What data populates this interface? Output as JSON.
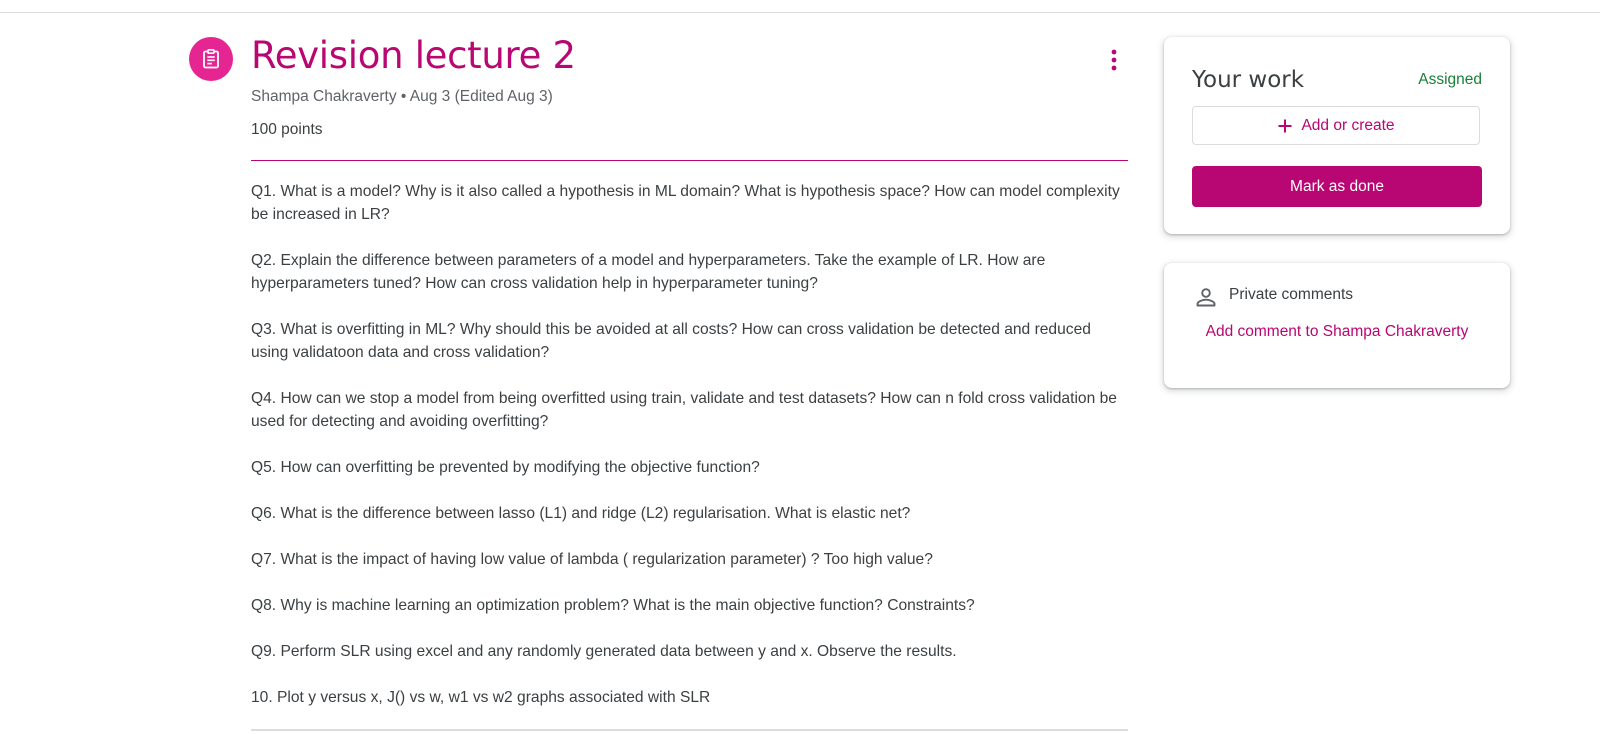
{
  "assignment": {
    "title": "Revision lecture 2",
    "meta": "Shampa Chakraverty • Aug 3 (Edited Aug 3)",
    "points": "100 points",
    "questions": [
      "Q1. What is a model? Why is it also called a hypothesis in ML domain? What is hypothesis space? How can model complexity be increased in LR?",
      "Q2. Explain the difference between parameters of a model and hyperparameters. Take the example of LR. How are hyperparameters tuned? How can cross validation help in hyperparameter tuning?",
      "Q3. What is overfitting in ML? Why should this be avoided at all costs? How can cross validation be detected and reduced using validatoon data and cross validation?",
      "Q4. How can we stop a model from being overfitted using train, validate and test datasets? How can n fold cross validation be used for detecting and avoiding overfitting?",
      "Q5. How can overfitting be prevented by modifying the objective function?",
      "Q6. What is the difference between lasso (L1) and ridge (L2) regularisation. What is elastic net?",
      "Q7. What is the impact of having low value of lambda ( regularization parameter) ? Too high value?",
      "Q8. Why is machine learning an optimization problem? What is the main objective function? Constraints?",
      "Q9. Perform SLR using excel and any randomly generated data between y and x. Observe the results.",
      "10. Plot y versus x, J() vs w, w1 vs w2 graphs associated with SLR"
    ]
  },
  "your_work": {
    "heading": "Your work",
    "status": "Assigned",
    "add_label": "Add or create",
    "done_label": "Mark as done"
  },
  "private_comments": {
    "label": "Private comments",
    "add_comment": "Add comment to Shampa Chakraverty"
  },
  "colors": {
    "accent": "#b80672",
    "icon_bg": "#e52592",
    "status_green": "#188038"
  },
  "icons": {
    "assignment": "assignment-icon",
    "more": "more-vert-icon",
    "add": "plus-icon",
    "person": "person-icon"
  }
}
